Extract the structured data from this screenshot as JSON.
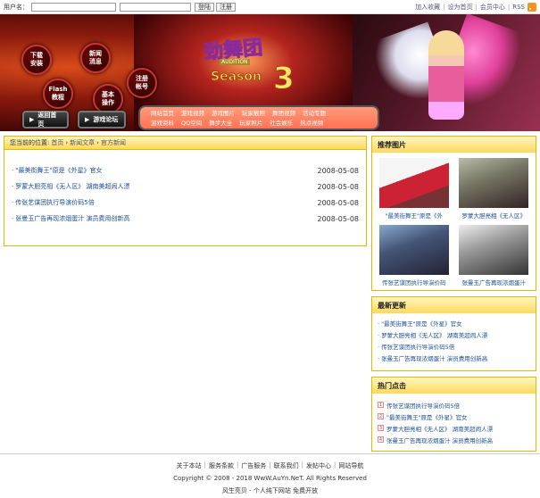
{
  "topbar": {
    "username_label": "用户名：",
    "login_label": "登陆",
    "register_label": "注册",
    "right_links": [
      "加入收藏",
      "设为首页",
      "会员中心",
      "RSS"
    ]
  },
  "banner": {
    "circle_buttons": [
      "下载\n安装",
      "新闻\n消息",
      "Flash\n教程",
      "基本\n操作",
      "注册\n帐号"
    ],
    "home_button": "返回首页",
    "forum_button": "游戏论坛",
    "menu_row1": [
      "网站首页",
      "游戏视频",
      "游戏图片",
      "玩家靓照",
      "舞团视频",
      "活动专题"
    ],
    "menu_row2": [
      "游戏资料",
      "QQ空间",
      "舞步大全",
      "玩家照片",
      "社会娱乐",
      "热点视频"
    ]
  },
  "breadcrumb": {
    "prefix": "您当前的位置:",
    "items": [
      "首页",
      "新闻文章",
      "官方新闻"
    ]
  },
  "articles": [
    {
      "title": "\"最美街舞王\"原是《外星》官女",
      "date": "2008-05-08"
    },
    {
      "title": "罗蒙大胆亮相《无人区》 湖南美超闹人漂",
      "date": "2008-05-08"
    },
    {
      "title": "传张艺谋团执行导演价码5倍",
      "date": "2008-05-08"
    },
    {
      "title": "张曼玉广告再现浓烟蛋汁 演员费用创新高",
      "date": "2008-05-08"
    }
  ],
  "sidebar": {
    "recommend_title": "推荐图片",
    "photos": [
      {
        "caption": "\"最美街舞王\"原是《外"
      },
      {
        "caption": "罗蒙大胆亮相《无人区》"
      },
      {
        "caption": "传张艺谋团执行导演价码"
      },
      {
        "caption": "张曼玉广告再现浓烟蛋汁"
      }
    ],
    "latest_title": "最新更新",
    "latest": [
      "\"最美街舞王\"原是《外星》官女",
      "罗蒙大胆亮相《无人区》 湖南美超闹人漂",
      "传张艺谋团执行导演价码5倍",
      "张曼玉广告再现浓烟蛋汁 演员费用创新高"
    ],
    "hot_title": "热门点击",
    "hot": [
      "传张艺谋团执行导演价码5倍",
      "\"最美街舞王\"原是《外星》官女",
      "罗蒙大胆亮相《无人区》 湖南美超闹人漂",
      "张曼玉广告再现浓烟蛋汁 演员费用创新高"
    ]
  },
  "footer": {
    "links": [
      "关于本站",
      "服务条款",
      "广告服务",
      "联系我们",
      "发帖中心",
      "网站导航"
    ],
    "copyright": "Copyright © 2008 - 2018 WwW.AuYn.NeT. All Rights Reserved",
    "tagline": "风生亮贝 - 个人纯下网站 免费开放"
  }
}
